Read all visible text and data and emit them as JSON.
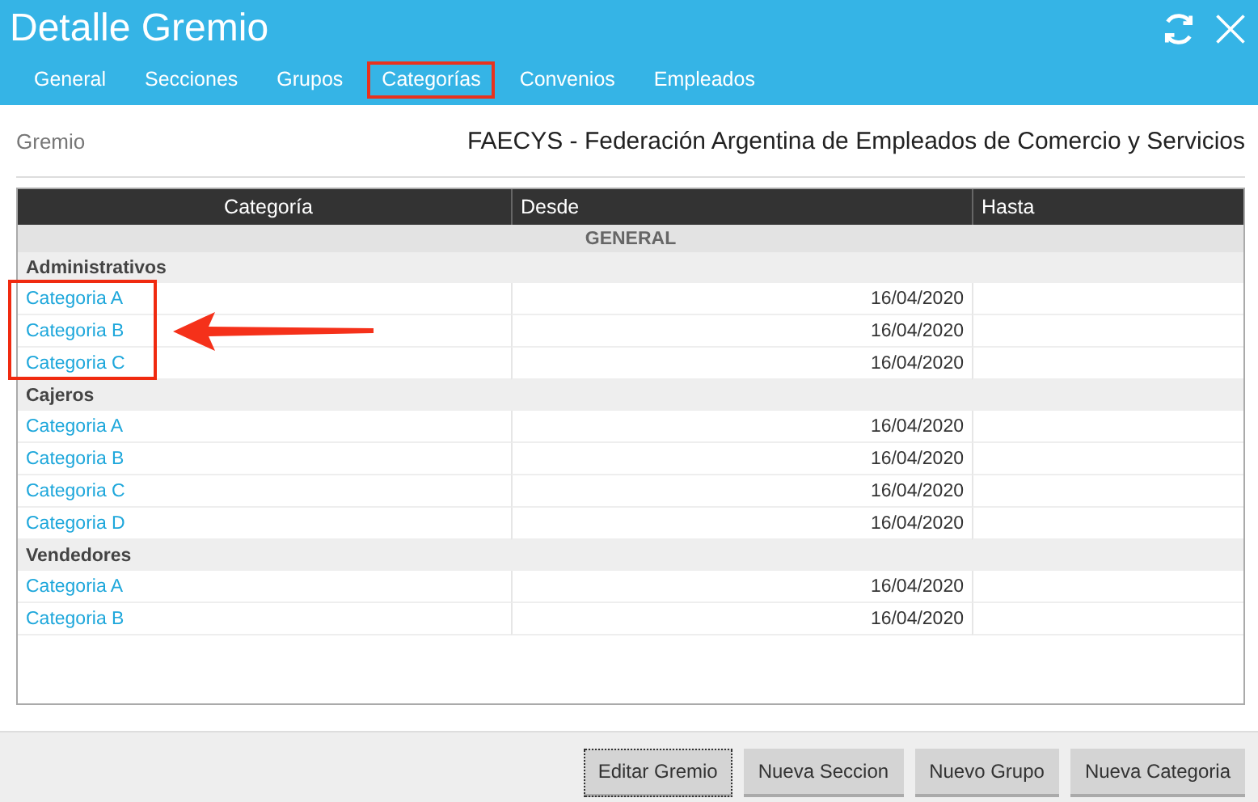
{
  "window": {
    "title": "Detalle Gremio"
  },
  "tabs": [
    {
      "label": "General",
      "highlighted": false
    },
    {
      "label": "Secciones",
      "highlighted": false
    },
    {
      "label": "Grupos",
      "highlighted": false
    },
    {
      "label": "Categorías",
      "highlighted": true
    },
    {
      "label": "Convenios",
      "highlighted": false
    },
    {
      "label": "Empleados",
      "highlighted": false
    }
  ],
  "gremio": {
    "label": "Gremio",
    "value": "FAECYS - Federación Argentina de Empleados de Comercio y Servicios"
  },
  "table": {
    "columns": [
      "Categoría",
      "Desde",
      "Hasta"
    ],
    "section": "GENERAL",
    "groups": [
      {
        "name": "Administrativos",
        "highlighted": true,
        "rows": [
          {
            "categoria": "Categoria A",
            "desde": "16/04/2020"
          },
          {
            "categoria": "Categoria B",
            "desde": "16/04/2020"
          },
          {
            "categoria": "Categoria C",
            "desde": "16/04/2020"
          }
        ]
      },
      {
        "name": "Cajeros",
        "highlighted": false,
        "rows": [
          {
            "categoria": "Categoria A",
            "desde": "16/04/2020"
          },
          {
            "categoria": "Categoria B",
            "desde": "16/04/2020"
          },
          {
            "categoria": "Categoria C",
            "desde": "16/04/2020"
          },
          {
            "categoria": "Categoria D",
            "desde": "16/04/2020"
          }
        ]
      },
      {
        "name": "Vendedores",
        "highlighted": false,
        "rows": [
          {
            "categoria": "Categoria A",
            "desde": "16/04/2020"
          },
          {
            "categoria": "Categoria B",
            "desde": "16/04/2020"
          }
        ]
      }
    ]
  },
  "buttons": [
    {
      "label": "Editar Gremio",
      "focused": true
    },
    {
      "label": "Nueva Seccion",
      "focused": false
    },
    {
      "label": "Nuevo Grupo",
      "focused": false
    },
    {
      "label": "Nueva Categoria",
      "focused": false
    }
  ]
}
